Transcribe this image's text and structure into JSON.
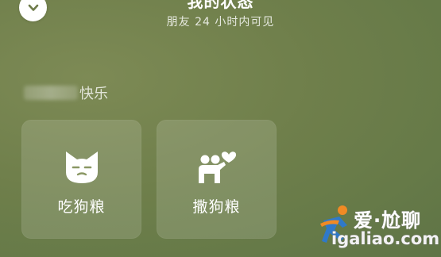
{
  "header": {
    "title": "我的状态",
    "subtitle": "朋友 24 小时内可见",
    "collapse_icon": "chevron-down-icon"
  },
  "section": {
    "label": "快乐",
    "blurred_name_icon": "blurred-text"
  },
  "statuses": [
    {
      "label": "吃狗粮",
      "icon": "cat-face-icon"
    },
    {
      "label": "撒狗粮",
      "icon": "couple-heart-icon"
    }
  ],
  "watermark": {
    "brand": "爱·尬聊",
    "domain": "igaliao.com",
    "colors": {
      "figure_orange": "#f08a24",
      "figure_blue": "#2f79c9"
    }
  },
  "colors": {
    "background": "#6f7f4b",
    "card": "rgba(255,255,255,0.14)",
    "text": "#ffffff"
  }
}
